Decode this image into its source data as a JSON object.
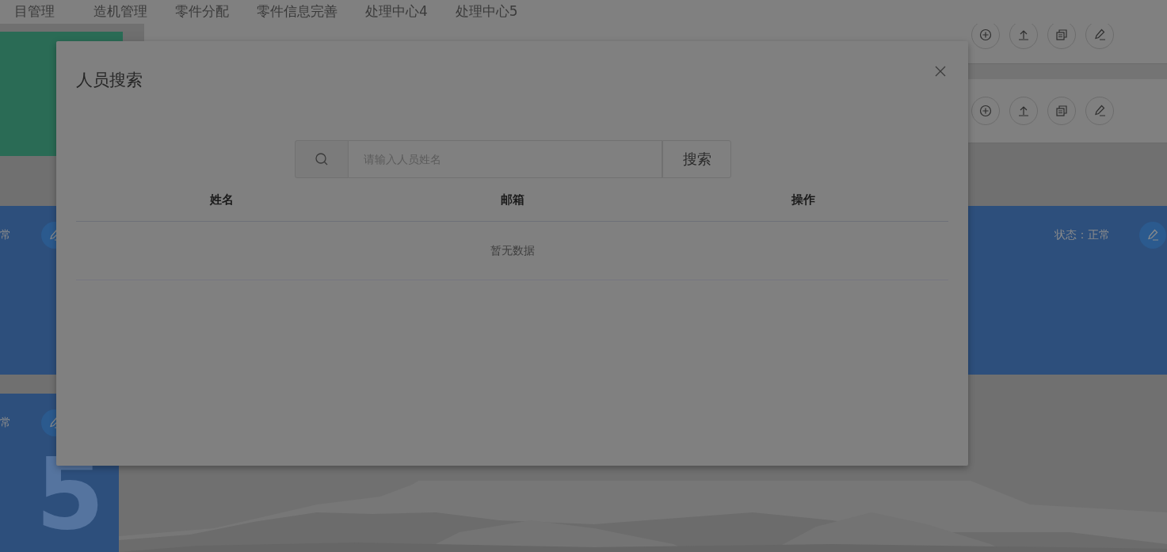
{
  "nav": [
    {
      "label": "目管理"
    },
    {
      "label": "造机管理"
    },
    {
      "label": "零件分配"
    },
    {
      "label": "零件信息完善"
    },
    {
      "label": "处理中心4"
    },
    {
      "label": "处理中心5"
    }
  ],
  "status_cards": [
    {
      "status": "常"
    },
    {
      "status": "状态：正常"
    },
    {
      "status": "常",
      "number": "5"
    }
  ],
  "modal": {
    "title": "人员搜索",
    "search": {
      "placeholder": "请输入人员姓名",
      "button": "搜索"
    },
    "table": {
      "columns": [
        "姓名",
        "邮箱",
        "操作"
      ],
      "empty_text": "暂无数据"
    }
  }
}
